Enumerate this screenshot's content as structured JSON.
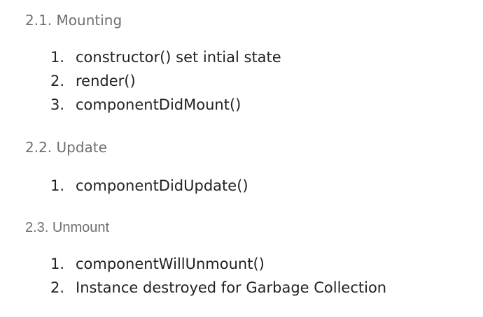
{
  "sections": [
    {
      "heading": "2.1. Mounting",
      "items": [
        {
          "num": "1.",
          "text": "constructor() set intial state"
        },
        {
          "num": "2.",
          "text": "render()"
        },
        {
          "num": "3.",
          "text": "componentDidMount()"
        }
      ]
    },
    {
      "heading": "2.2. Update",
      "items": [
        {
          "num": "1.",
          "text": "componentDidUpdate()"
        }
      ]
    },
    {
      "heading": "2.3. Unmount",
      "items": [
        {
          "num": "1.",
          "text": "componentWillUnmount()"
        },
        {
          "num": "2.",
          "text": "Instance destroyed for Garbage Collection"
        }
      ]
    }
  ]
}
